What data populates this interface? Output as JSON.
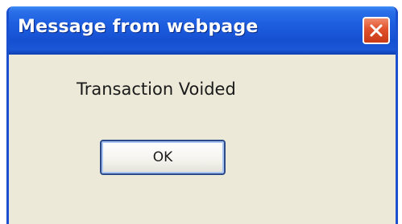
{
  "dialog": {
    "title": "Message from webpage",
    "message": "Transaction Voided",
    "ok_label": "OK",
    "close_icon": "close-icon"
  },
  "colors": {
    "titlebar": "#1650d2",
    "body": "#ece9d8",
    "close_button": "#e0502c"
  }
}
